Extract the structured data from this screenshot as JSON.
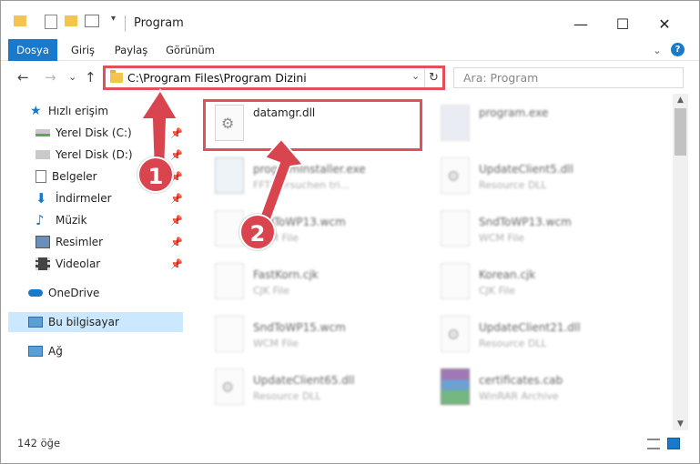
{
  "window": {
    "title": "Program",
    "minimize": "—",
    "maximize": "☐",
    "close": "✕"
  },
  "ribbon": {
    "tabs": [
      {
        "label": "Dosya",
        "active": true
      },
      {
        "label": "Giriş",
        "active": false
      },
      {
        "label": "Paylaş",
        "active": false
      },
      {
        "label": "Görünüm",
        "active": false
      }
    ],
    "expand": "⌄",
    "help": "?"
  },
  "address": {
    "back": "←",
    "forward": "→",
    "recent": "⌄",
    "up": "↑",
    "path": "C:\\Program Files\\Program Dizini",
    "dropdown": "⌄",
    "refresh": "↻",
    "search_placeholder": "Ara: Program"
  },
  "sidebar": {
    "quick_access": "Hızlı erişim",
    "items": [
      {
        "label": "Yerel Disk (C:)",
        "icon": "drive-icon"
      },
      {
        "label": "Yerel Disk (D:)",
        "icon": "drive-icon"
      },
      {
        "label": "Belgeler",
        "icon": "documents-icon"
      },
      {
        "label": "İndirmeler",
        "icon": "downloads-icon"
      },
      {
        "label": "Müzik",
        "icon": "music-icon"
      },
      {
        "label": "Resimler",
        "icon": "pictures-icon"
      },
      {
        "label": "Videolar",
        "icon": "videos-icon"
      }
    ],
    "onedrive": "OneDrive",
    "this_pc": "Bu bilgisayar",
    "network": "Ağ"
  },
  "files": {
    "highlighted": {
      "name": "datamgr.dll"
    },
    "left": [
      {
        "name": "programInstaller.exe",
        "type": "FFT Versuchen tri..."
      },
      {
        "name": "SndToWP13.wcm",
        "type": "WCM File"
      },
      {
        "name": "FastKorn.cjk",
        "type": "CJK File"
      },
      {
        "name": "SndToWP15.wcm",
        "type": "WCM File"
      },
      {
        "name": "UpdateClient65.dll",
        "type": "Resource DLL"
      }
    ],
    "right": [
      {
        "name": "program.exe",
        "type": ""
      },
      {
        "name": "UpdateClient5.dll",
        "type": "Resource DLL"
      },
      {
        "name": "SndToWP13.wcm",
        "type": "WCM File"
      },
      {
        "name": "Korean.cjk",
        "type": "CJK File"
      },
      {
        "name": "UpdateClient21.dll",
        "type": "Resource DLL"
      },
      {
        "name": "certificates.cab",
        "type": "WinRAR Archive"
      }
    ]
  },
  "status": {
    "item_count": "142 öğe"
  },
  "annotations": {
    "step1": "1",
    "step2": "2"
  },
  "colors": {
    "accent": "#1979ca",
    "highlight": "#e2505a",
    "badge": "#d9454e",
    "selected": "#cce8ff"
  }
}
